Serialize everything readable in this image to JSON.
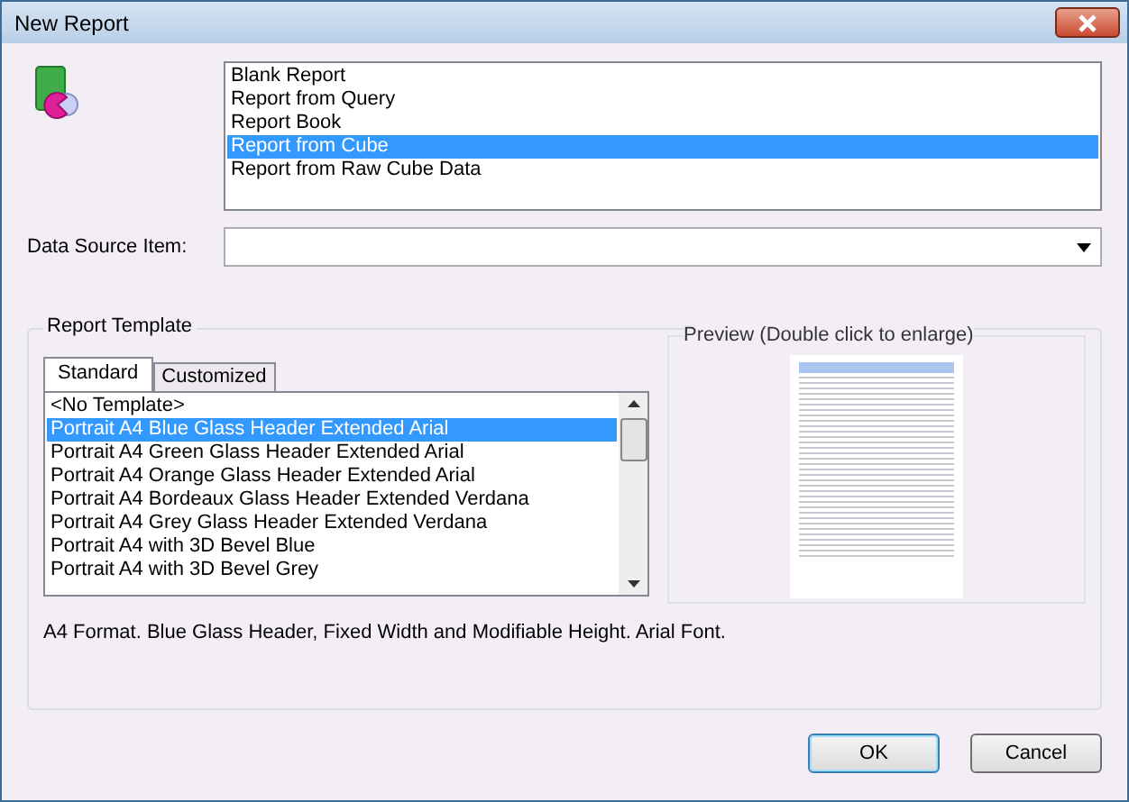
{
  "window": {
    "title": "New Report"
  },
  "report_types": [
    {
      "label": "Blank Report",
      "selected": false
    },
    {
      "label": "Report from Query",
      "selected": false
    },
    {
      "label": "Report Book",
      "selected": false
    },
    {
      "label": "Report from Cube",
      "selected": true
    },
    {
      "label": "Report from Raw Cube Data",
      "selected": false
    }
  ],
  "data_source": {
    "label": "Data Source Item:"
  },
  "report_template": {
    "title": "Report Template",
    "tabs": [
      {
        "label": "Standard",
        "selected": true
      },
      {
        "label": "Customized",
        "selected": false
      }
    ],
    "templates": [
      {
        "label": "<No Template>",
        "selected": false
      },
      {
        "label": "Portrait A4 Blue Glass Header Extended Arial",
        "selected": true
      },
      {
        "label": "Portrait A4 Green Glass Header Extended Arial",
        "selected": false
      },
      {
        "label": "Portrait A4 Orange Glass Header Extended Arial",
        "selected": false
      },
      {
        "label": "Portrait A4 Bordeaux Glass Header Extended Verdana",
        "selected": false
      },
      {
        "label": "Portrait A4 Grey Glass Header Extended Verdana",
        "selected": false
      },
      {
        "label": "Portrait A4 with 3D Bevel Blue",
        "selected": false
      },
      {
        "label": "Portrait A4 with 3D Bevel Grey",
        "selected": false
      }
    ],
    "preview_title": "Preview (Double click to enlarge)",
    "description": "A4 Format. Blue Glass Header, Fixed Width and Modifiable Height. Arial Font."
  },
  "buttons": [
    "OK",
    "Cancel"
  ]
}
